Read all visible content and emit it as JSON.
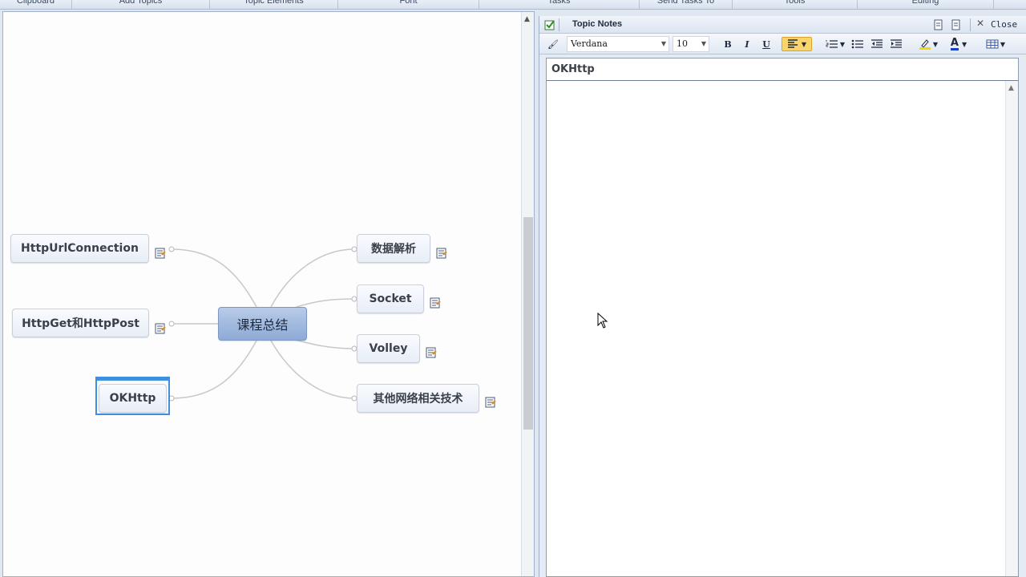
{
  "ribbon": {
    "groups": [
      {
        "label": "Clipboard"
      },
      {
        "label": "Add Topics"
      },
      {
        "label": "Topic Elements"
      },
      {
        "label": "Font"
      },
      {
        "label": "Tasks"
      },
      {
        "label": "Send Tasks To"
      },
      {
        "label": "Tools"
      },
      {
        "label": "Editing"
      }
    ]
  },
  "map": {
    "central": "课程总结",
    "left_topics": [
      "HttpUrlConnection",
      "HttpGet和HttpPost",
      "OKHttp"
    ],
    "right_topics": [
      "数据解析",
      "Socket",
      "Volley",
      "其他网络相关技术"
    ]
  },
  "notes": {
    "title": "Topic Notes",
    "close_label": "Close",
    "font_name": "Verdana",
    "font_size": "10",
    "bold_label": "B",
    "italic_label": "I",
    "underline_label": "U",
    "font_color_label": "A",
    "topic_heading": "OKHttp"
  },
  "colors": {
    "central_fill": "#9fb6de",
    "selection": "#3d8fe0",
    "connector": "#c8c8c8"
  }
}
